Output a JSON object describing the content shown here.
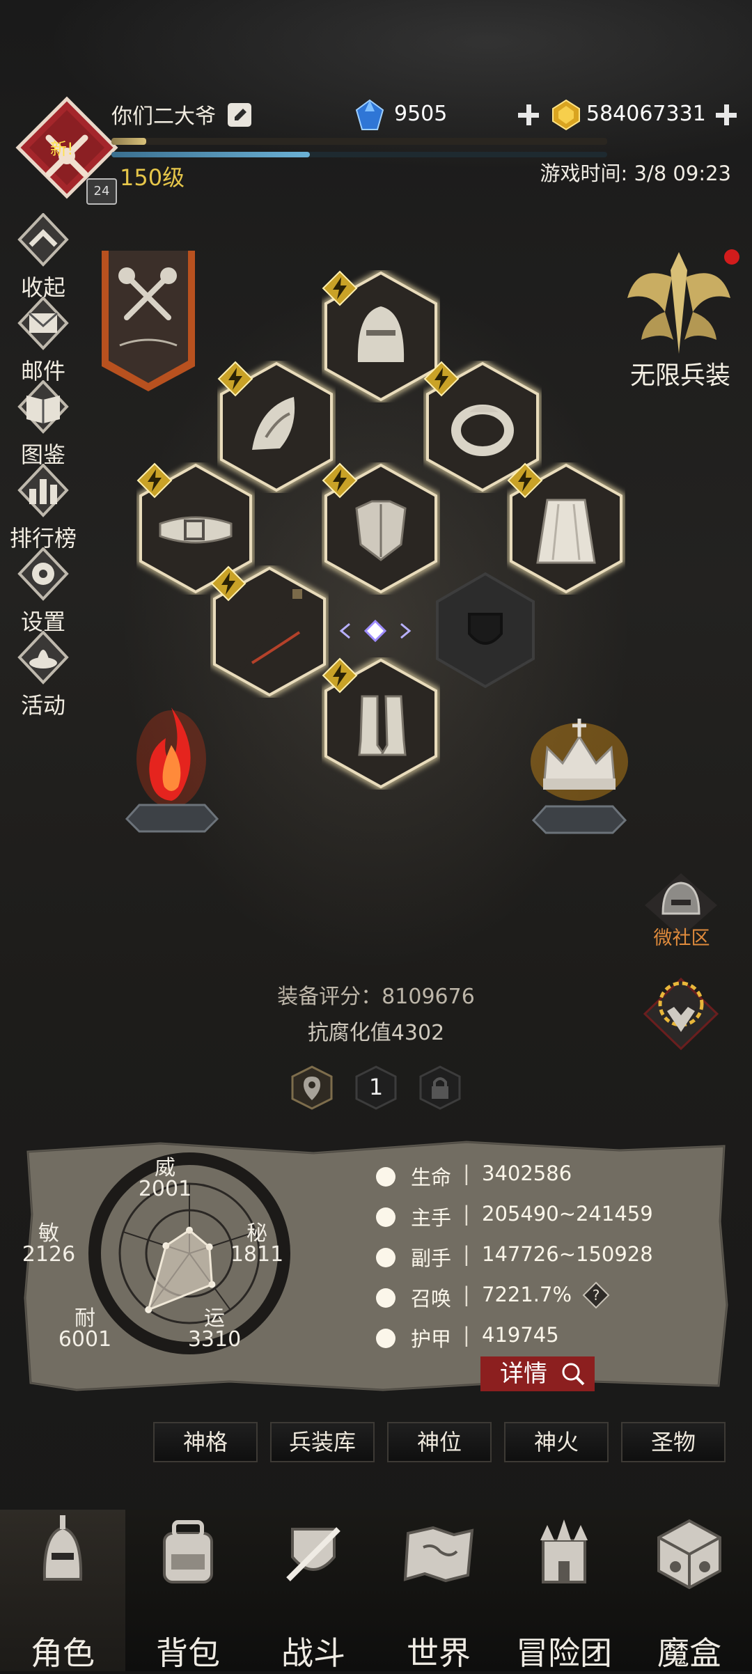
{
  "player": {
    "name": "你们二大爷",
    "level": "150级",
    "badge_text": "新!",
    "rank_badge": "24",
    "exp_fraction": 0.07,
    "mp_fraction": 0.4
  },
  "currency": {
    "gems": "9505",
    "gold": "584067331"
  },
  "game_time": "游戏时间: 3/8 09:23",
  "sidebar": [
    {
      "label": "收起",
      "icon": "collapse-icon"
    },
    {
      "label": "邮件",
      "icon": "mail-icon"
    },
    {
      "label": "图鉴",
      "icon": "book-icon"
    },
    {
      "label": "排行榜",
      "icon": "ranking-icon"
    },
    {
      "label": "设置",
      "icon": "gear-icon"
    },
    {
      "label": "活动",
      "icon": "event-icon"
    }
  ],
  "right_panel": {
    "unlimited_label": "无限兵装",
    "community_label": "微社区"
  },
  "equipment": {
    "score": "装备评分：8109676",
    "corruption": "抗腐化值4302",
    "page": "1"
  },
  "radar": {
    "stats": [
      {
        "name": "威",
        "value": "2001"
      },
      {
        "name": "秘",
        "value": "1811"
      },
      {
        "name": "运",
        "value": "3310"
      },
      {
        "name": "耐",
        "value": "6001"
      },
      {
        "name": "敏",
        "value": "2126"
      }
    ]
  },
  "stats": [
    {
      "label": "生命",
      "value": "3402586",
      "icon": "heart-icon"
    },
    {
      "label": "主手",
      "value": "205490~241459",
      "icon": "sword-icon"
    },
    {
      "label": "副手",
      "value": "147726~150928",
      "icon": "offhand-icon"
    },
    {
      "label": "召唤",
      "value": "7221.7%",
      "icon": "summon-icon"
    },
    {
      "label": "护甲",
      "value": "419745",
      "icon": "armor-icon"
    }
  ],
  "detail_button": "详情",
  "tabs": [
    "神格",
    "兵装库",
    "神位",
    "神火",
    "圣物"
  ],
  "nav": [
    {
      "label": "角色",
      "icon": "helmet-icon",
      "active": true
    },
    {
      "label": "背包",
      "icon": "backpack-icon"
    },
    {
      "label": "战斗",
      "icon": "battle-icon"
    },
    {
      "label": "世界",
      "icon": "map-icon"
    },
    {
      "label": "冒险团",
      "icon": "castle-icon"
    },
    {
      "label": "魔盒",
      "icon": "cube-icon"
    }
  ]
}
